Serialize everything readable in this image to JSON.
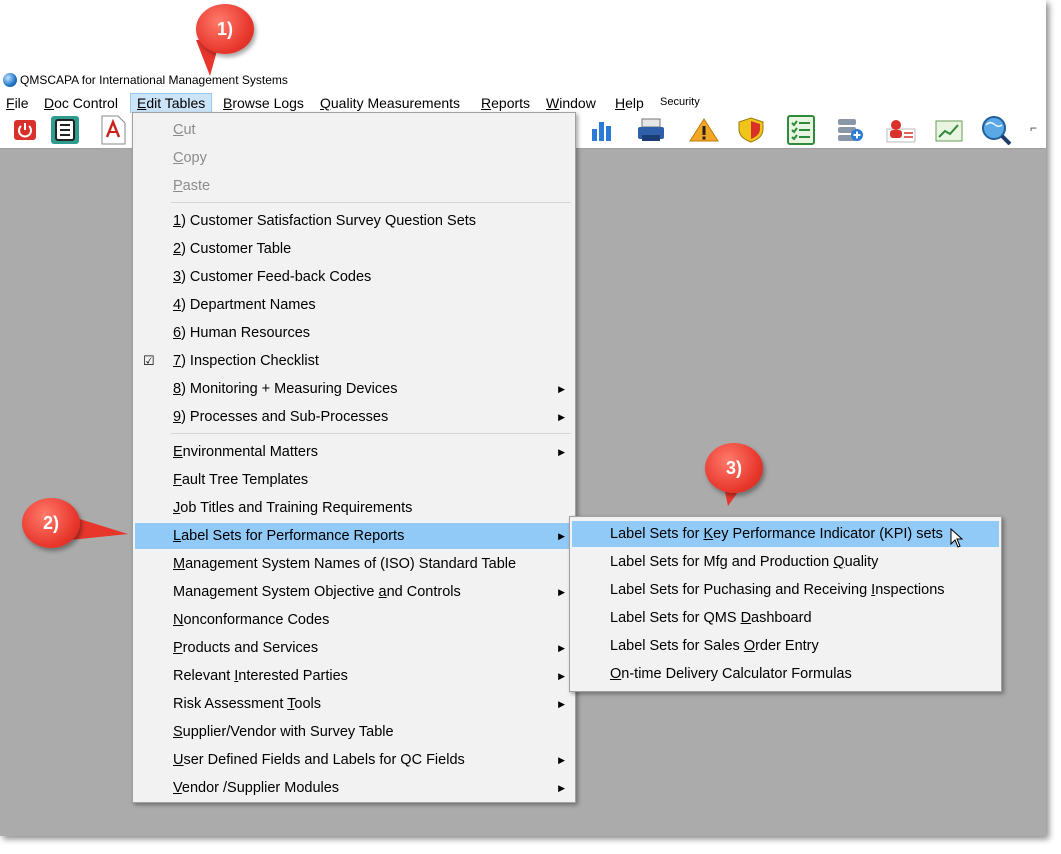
{
  "window": {
    "title": "QMSCAPA for International Management Systems"
  },
  "menubar": {
    "items": [
      {
        "pre": "",
        "u": "F",
        "post": "ile"
      },
      {
        "pre": "",
        "u": "D",
        "post": "oc Control"
      },
      {
        "pre": "",
        "u": "E",
        "post": "dit Tables"
      },
      {
        "pre": "",
        "u": "B",
        "post": "rowse Logs"
      },
      {
        "pre": "",
        "u": "Q",
        "post": "uality Measurements"
      },
      {
        "pre": "",
        "u": "R",
        "post": "eports"
      },
      {
        "pre": "",
        "u": "W",
        "post": "indow"
      },
      {
        "pre": "",
        "u": "H",
        "post": "elp"
      }
    ],
    "security": "Security"
  },
  "toolbar": {
    "icons": [
      "power-icon",
      "document-list-icon",
      "pdf-icon",
      "bar-chart-icon",
      "printer-icon",
      "warning-icon",
      "shield-icon",
      "checklist-icon",
      "server-add-icon",
      "person-card-icon",
      "trend-chart-icon",
      "globe-search-icon"
    ]
  },
  "edit_menu": {
    "items": [
      {
        "pre": "",
        "u": "C",
        "post": "ut",
        "disabled": true
      },
      {
        "pre": "",
        "u": "C",
        "post": "opy",
        "disabled": true
      },
      {
        "pre": "",
        "u": "P",
        "post": "aste",
        "disabled": true
      },
      {
        "pre": "",
        "u": "1",
        "post": ") Customer Satisfaction Survey Question Sets"
      },
      {
        "pre": "",
        "u": "2",
        "post": ") Customer Table"
      },
      {
        "pre": "",
        "u": "3",
        "post": ") Customer Feed-back Codes"
      },
      {
        "pre": "",
        "u": "4",
        "post": ") Department Names"
      },
      {
        "pre": "",
        "u": "6",
        "post": ") Human Resources"
      },
      {
        "pre": "",
        "u": "7",
        "post": ") Inspection Checklist",
        "checked": true
      },
      {
        "pre": "",
        "u": "8",
        "post": ") Monitoring + Measuring Devices",
        "submenu": true
      },
      {
        "pre": "",
        "u": "9",
        "post": ") Processes and Sub-Processes",
        "submenu": true
      },
      {
        "pre": "",
        "u": "E",
        "post": "nvironmental Matters",
        "submenu": true
      },
      {
        "pre": "",
        "u": "F",
        "post": "ault Tree Templates"
      },
      {
        "pre": "",
        "u": "J",
        "post": "ob Titles and Training Requirements"
      },
      {
        "pre": "",
        "u": "L",
        "post": "abel Sets for Performance Reports",
        "submenu": true,
        "highlighted": true
      },
      {
        "pre": "",
        "u": "M",
        "post": "anagement System Names of (ISO) Standard Table"
      },
      {
        "pre": "Management System Objective ",
        "u": "a",
        "post": "nd Controls",
        "submenu": true
      },
      {
        "pre": "",
        "u": "N",
        "post": "onconformance Codes"
      },
      {
        "pre": "",
        "u": "P",
        "post": "roducts and Services",
        "submenu": true
      },
      {
        "pre": "Relevant ",
        "u": "I",
        "post": "nterested Parties",
        "submenu": true
      },
      {
        "pre": "Risk Assessment ",
        "u": "T",
        "post": "ools",
        "submenu": true
      },
      {
        "pre": "",
        "u": "S",
        "post": "upplier/Vendor with Survey Table"
      },
      {
        "pre": "",
        "u": "U",
        "post": "ser Defined Fields and Labels for QC Fields",
        "submenu": true
      },
      {
        "pre": "",
        "u": "V",
        "post": "endor /Supplier Modules",
        "submenu": true
      }
    ]
  },
  "sub_menu": {
    "items": [
      {
        "pre": "Label Sets for ",
        "u": "K",
        "post": "ey Performance Indicator (KPI) sets",
        "highlighted": true
      },
      {
        "pre": "Label Sets for Mfg and Production ",
        "u": "Q",
        "post": "uality"
      },
      {
        "pre": "Label Sets for Puchasing and Receiving ",
        "u": "I",
        "post": "nspections"
      },
      {
        "pre": "Label Sets for QMS ",
        "u": "D",
        "post": "ashboard"
      },
      {
        "pre": "Label Sets for Sales ",
        "u": "O",
        "post": "rder Entry"
      },
      {
        "pre": "",
        "u": "O",
        "post": "n-time Delivery Calculator Formulas"
      }
    ]
  },
  "callouts": [
    "1)",
    "2)",
    "3)"
  ],
  "colors": {
    "highlight": "#91c9f7",
    "workspace": "#ababab",
    "callout": "#e8362c"
  }
}
